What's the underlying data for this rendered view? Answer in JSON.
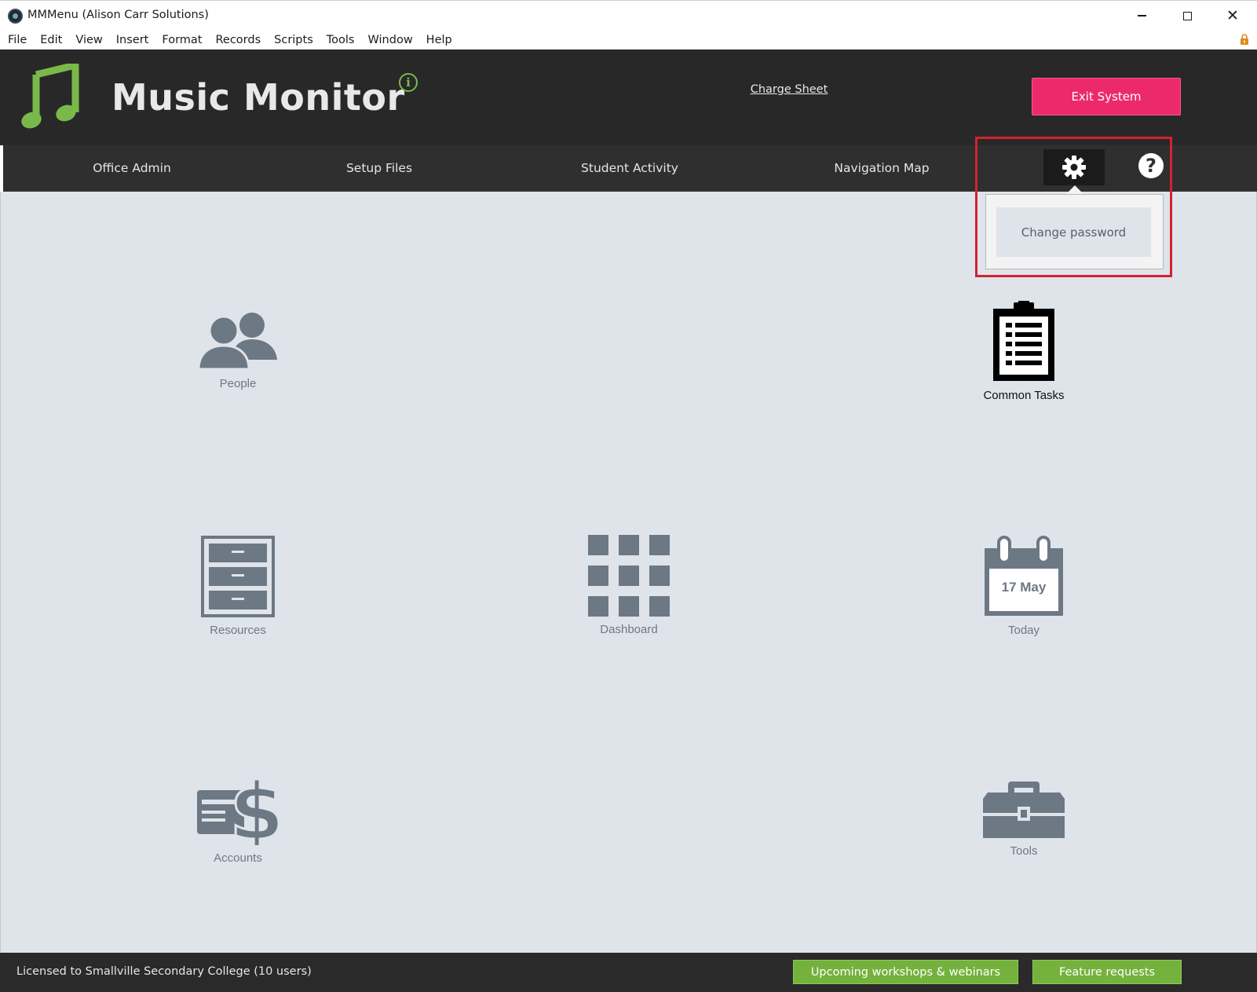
{
  "window": {
    "title": "MMMenu (Alison Carr Solutions)"
  },
  "menubar": {
    "items": [
      "File",
      "Edit",
      "View",
      "Insert",
      "Format",
      "Records",
      "Scripts",
      "Tools",
      "Window",
      "Help"
    ]
  },
  "header": {
    "brand": "Music Monitor",
    "info_icon": "i",
    "charge_sheet": "Charge Sheet",
    "exit_button": "Exit System"
  },
  "nav": {
    "office_admin": "Office Admin",
    "setup_files": "Setup Files",
    "student_activity": "Student Activity",
    "navigation_map": "Navigation Map",
    "help_icon": "?"
  },
  "settings_menu": {
    "change_password": "Change password"
  },
  "tiles": {
    "people": "People",
    "common_tasks": "Common Tasks",
    "resources": "Resources",
    "dashboard": "Dashboard",
    "today": "Today",
    "today_date": "17 May",
    "accounts": "Accounts",
    "tools": "Tools"
  },
  "footer": {
    "license": "Licensed to Smallville Secondary College (10 users)",
    "workshops_button": "Upcoming workshops & webinars",
    "features_button": "Feature requests"
  },
  "colors": {
    "header_bg": "#282828",
    "nav_bg": "#2f2f2f",
    "main_bg": "#dfe4ea",
    "exit_button": "#ec2a6b",
    "green_accent": "#74b23d",
    "icon_gray": "#6d7885",
    "highlight_red": "#d6212e"
  }
}
